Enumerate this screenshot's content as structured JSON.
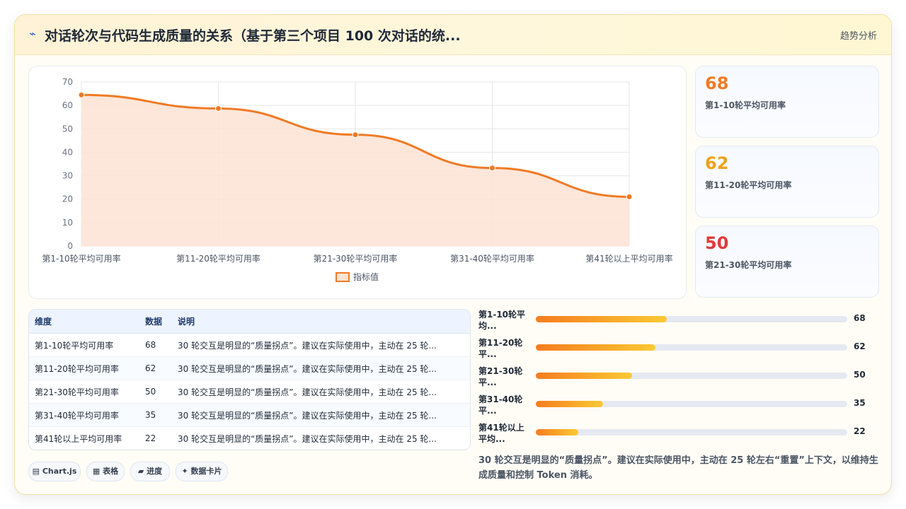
{
  "header": {
    "icon": "wave-icon",
    "title": "对话轮次与代码生成质量的关系（基于第三个项目 100 次对话的统...",
    "action_label": "趋势分析"
  },
  "chart_data": {
    "type": "area",
    "categories": [
      "第1-10轮平均可用率",
      "第11-20轮平均可用率",
      "第21-30轮平均可用率",
      "第31-40轮平均可用率",
      "第41轮以上平均可用率"
    ],
    "series": [
      {
        "name": "指标值",
        "values": [
          64.5,
          58.7,
          47.5,
          33.3,
          21.0
        ],
        "color": "#f07a25"
      }
    ],
    "ylim": [
      0,
      70
    ],
    "yticks": [
      0,
      10,
      20,
      30,
      40,
      50,
      60,
      70
    ],
    "grid": true,
    "legend": "bottom"
  },
  "kpis": [
    {
      "value": "68",
      "label": "第1-10轮平均可用率",
      "color": "#f07a25"
    },
    {
      "value": "62",
      "label": "第11-20轮平均可用率",
      "color": "#f0a11a"
    },
    {
      "value": "50",
      "label": "第21-30轮平均可用率",
      "color": "#e03a3a"
    }
  ],
  "table": {
    "headers": [
      "维度",
      "数据",
      "说明"
    ],
    "rows": [
      [
        "第1-10轮平均可用率",
        "68",
        "30 轮交互是明显的“质量拐点”。建议在实际使用中，主动在 25 轮..."
      ],
      [
        "第11-20轮平均可用率",
        "62",
        "30 轮交互是明显的“质量拐点”。建议在实际使用中，主动在 25 轮..."
      ],
      [
        "第21-30轮平均可用率",
        "50",
        "30 轮交互是明显的“质量拐点”。建议在实际使用中，主动在 25 轮..."
      ],
      [
        "第31-40轮平均可用率",
        "35",
        "30 轮交互是明显的“质量拐点”。建议在实际使用中，主动在 25 轮..."
      ],
      [
        "第41轮以上平均可用率",
        "22",
        "30 轮交互是明显的“质量拐点”。建议在实际使用中，主动在 25 轮..."
      ]
    ]
  },
  "chips": [
    {
      "icon": "chart-icon",
      "glyph": "▤",
      "label": "Chart.js"
    },
    {
      "icon": "table-icon",
      "glyph": "▦",
      "label": "表格"
    },
    {
      "icon": "progress-icon",
      "glyph": "▰",
      "label": "进度"
    },
    {
      "icon": "card-icon",
      "glyph": "✦",
      "label": "数据卡片"
    }
  ],
  "progress": [
    {
      "label": "第1-10轮平\n均...",
      "value": 68,
      "fraction": 0.42
    },
    {
      "label": "第11-20轮\n平...",
      "value": 62,
      "fraction": 0.385
    },
    {
      "label": "第21-30轮\n平...",
      "value": 50,
      "fraction": 0.31
    },
    {
      "label": "第31-40轮\n平...",
      "value": 35,
      "fraction": 0.217
    },
    {
      "label": "第41轮以上\n平均...",
      "value": 22,
      "fraction": 0.137
    }
  ],
  "note": "30 轮交互是明显的“质量拐点”。建议在实际使用中，主动在 25 轮左右“重置”上下文，以维持生成质量和控制 Token 消耗。"
}
